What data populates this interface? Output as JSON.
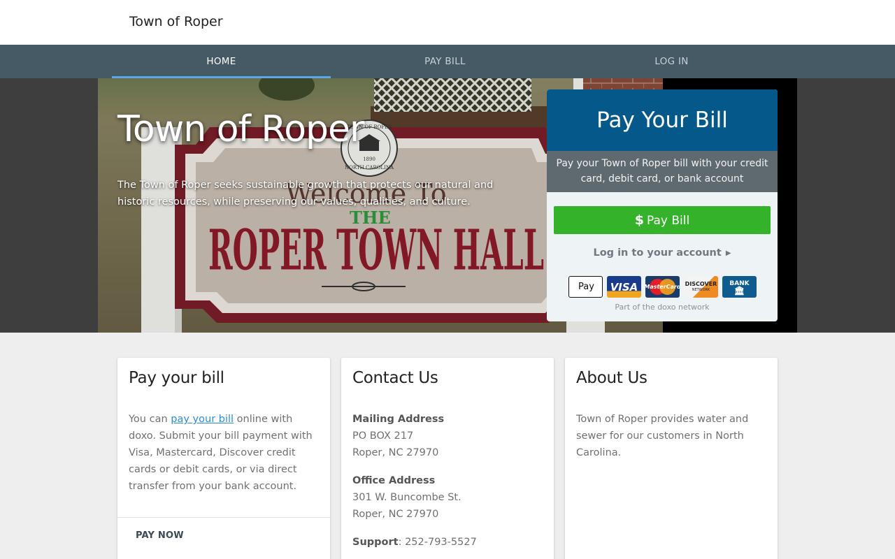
{
  "header": {
    "site_title": "Town of Roper"
  },
  "nav": {
    "tabs": [
      {
        "label": "HOME"
      },
      {
        "label": "PAY BILL"
      },
      {
        "label": "LOG IN"
      }
    ],
    "active_index": 0
  },
  "hero": {
    "title": "Town of Roper",
    "description": "The Town of Roper seeks sustainable growth that protects our natural and historic resources, while preserving our values, qualities, and culture.",
    "sign_text": {
      "line1": "Welcome To",
      "line2": "THE",
      "line3": "ROPER TOWN HALL",
      "seal_top": "TOWN OF ROPER",
      "seal_bottom": "NORTH CAROLINA",
      "seal_year": "1890"
    }
  },
  "widget": {
    "title": "Pay Your Bill",
    "subtitle": "Pay your Town of Roper bill with your credit card, debit card, or bank account",
    "pay_button": "Pay Bill",
    "pay_icon": "$",
    "login_link": "Log in to your account",
    "cards": {
      "apple": "Pay",
      "visa": "VISA",
      "master": "MasterCard",
      "discover": "DISCOVER",
      "discover_sub": "NETWORK",
      "bank": "BANK"
    },
    "network_note": "Part of the doxo network",
    "colors": {
      "header": "#05598a",
      "button": "#34b22a"
    }
  },
  "panels": {
    "pay": {
      "title": "Pay your bill",
      "text_before": "You can ",
      "link": "pay your bill",
      "text_after": " online with doxo. Submit your bill payment with Visa, Mastercard, Discover credit cards or debit cards, or via direct transfer from your bank account.",
      "action": "PAY NOW"
    },
    "contact": {
      "title": "Contact Us",
      "mailing_label": "Mailing Address",
      "mailing_line1": "PO BOX 217",
      "mailing_line2": "Roper, NC 27970",
      "office_label": "Office Address",
      "office_line1": "301 W. Buncombe St.",
      "office_line2": "Roper, NC 27970",
      "support_label": "Support",
      "support_value": ": 252-793-5527"
    },
    "about": {
      "title": "About Us",
      "text": "Town of Roper provides water and sewer for our customers in North Carolina."
    }
  }
}
